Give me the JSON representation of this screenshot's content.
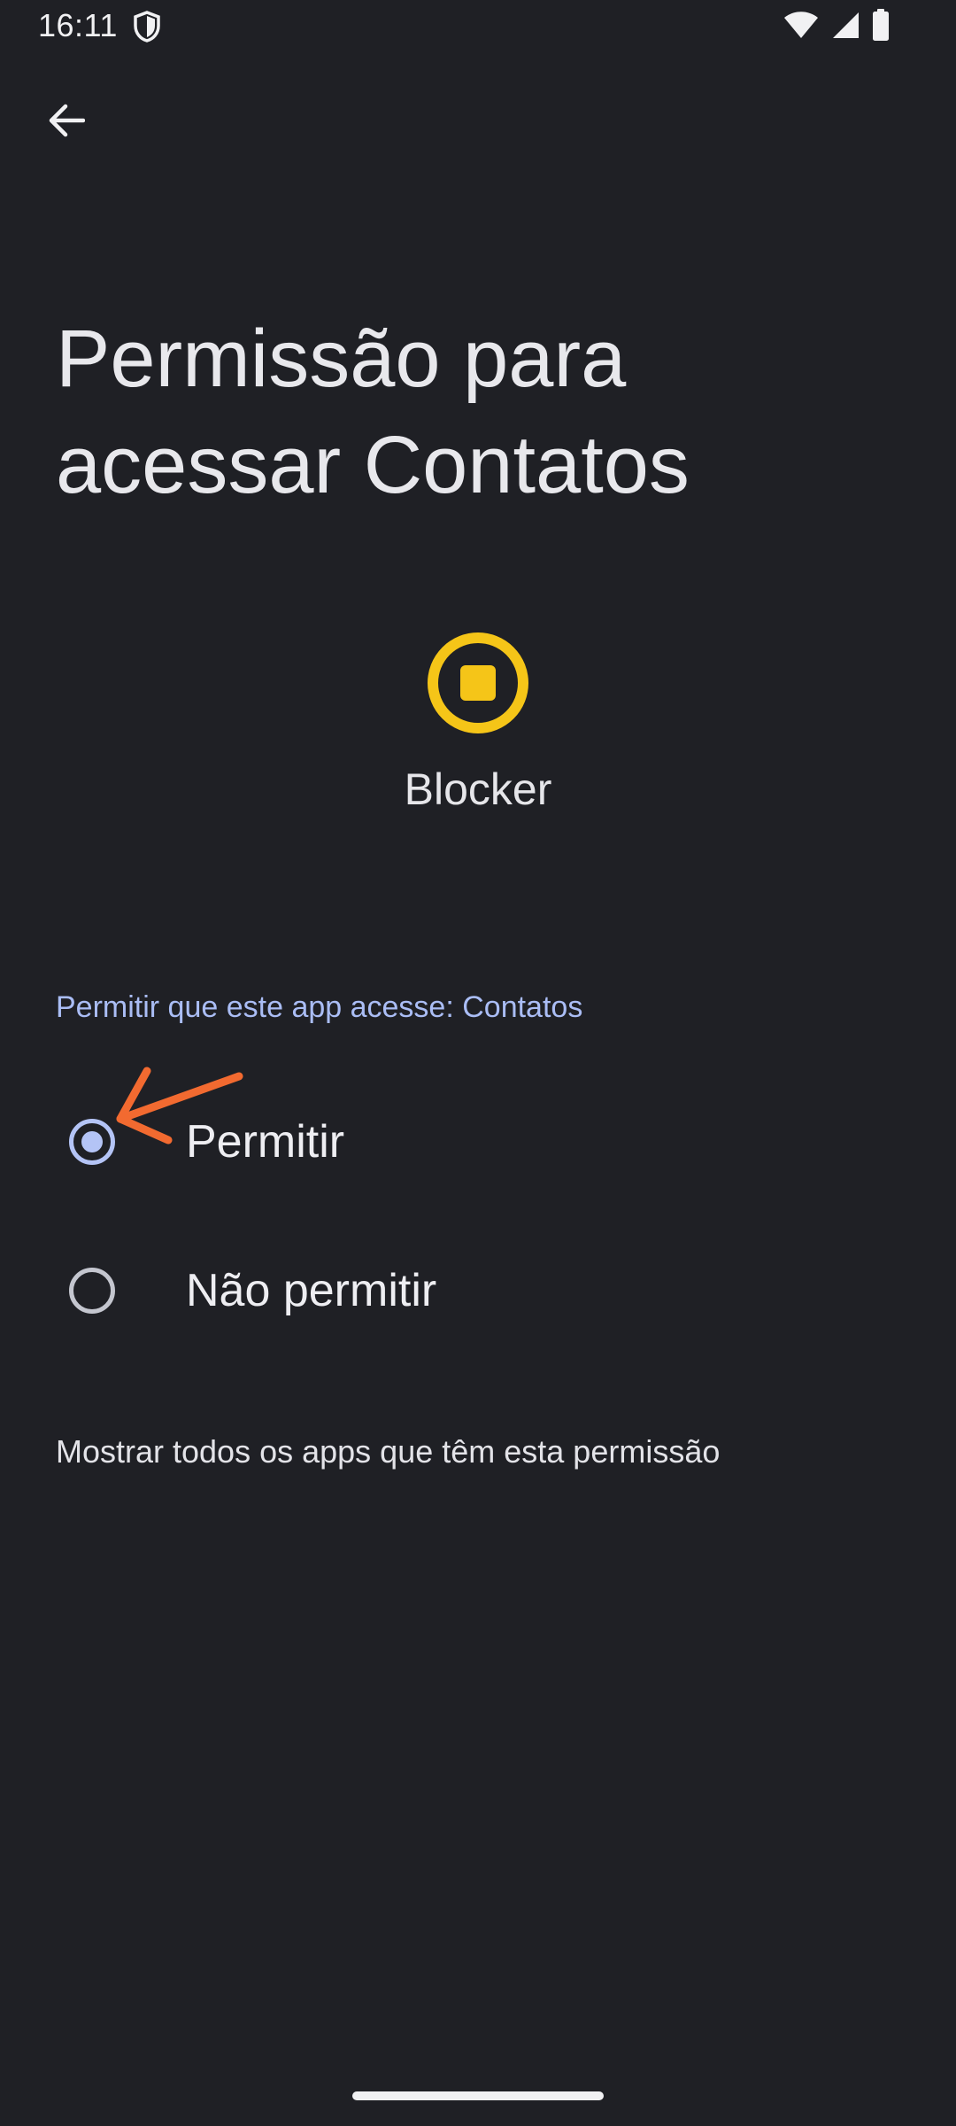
{
  "status_bar": {
    "time": "16:11",
    "icons": [
      "shield-icon",
      "wifi-icon",
      "cell-signal-icon",
      "battery-icon"
    ]
  },
  "toolbar": {
    "back_icon": "arrow-left-icon"
  },
  "header": {
    "title_line1": "Permissão para",
    "title_line2": "acessar Contatos"
  },
  "app": {
    "name": "Blocker",
    "icon": "stop-circle-icon",
    "icon_color": "#f5c518"
  },
  "permission": {
    "section_label": "Permitir que este app acesse: Contatos",
    "options": [
      {
        "label": "Permitir",
        "selected": true
      },
      {
        "label": "Não permitir",
        "selected": false
      }
    ],
    "show_all_label": "Mostrar todos os apps que têm esta permissão"
  },
  "colors": {
    "background": "#1f2025",
    "accent": "#b4c4f6",
    "annotation": "#f26a30"
  }
}
